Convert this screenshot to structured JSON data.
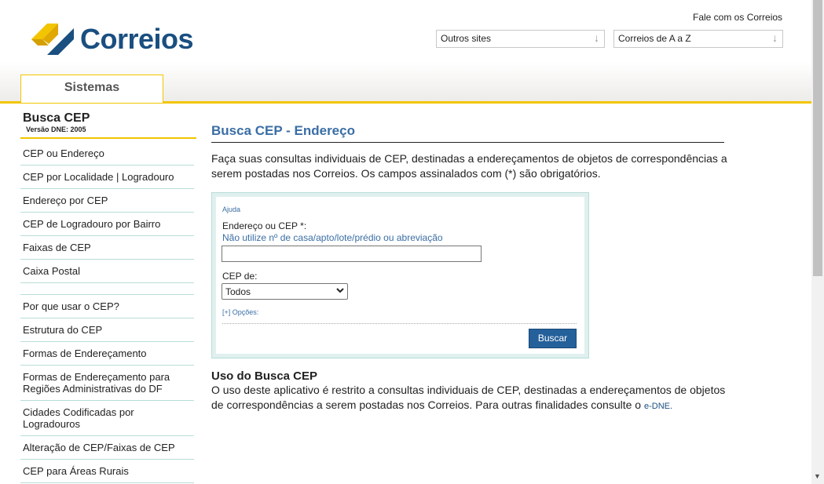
{
  "header": {
    "logo_text": "Correios",
    "fale_link": "Fale com os Correios",
    "dropdown1": "Outros sites",
    "dropdown2": "Correios de A a Z",
    "tab": "Sistemas"
  },
  "sidebar": {
    "title": "Busca CEP",
    "version": "Versão DNE: 2005",
    "items": [
      {
        "label": "CEP ou Endereço"
      },
      {
        "label": "CEP por Localidade | Logradouro"
      },
      {
        "label": "Endereço por CEP"
      },
      {
        "label": "CEP de Logradouro por Bairro"
      },
      {
        "label": "Faixas de CEP"
      },
      {
        "label": "Caixa Postal"
      },
      {
        "label": ""
      },
      {
        "label": "Por que usar o CEP?"
      },
      {
        "label": "Estrutura do CEP"
      },
      {
        "label": "Formas de Endereçamento"
      },
      {
        "label": "Formas de Endereçamento para Regiões Administrativas do DF"
      },
      {
        "label": "Cidades Codificadas por Logradouros"
      },
      {
        "label": "Alteração de CEP/Faixas de CEP"
      },
      {
        "label": "CEP para Áreas Rurais"
      }
    ]
  },
  "main": {
    "title": "Busca CEP - Endereço",
    "intro": "Faça suas consultas individuais de CEP, destinadas a endereçamentos de objetos de correspondências a serem postadas nos Correios. Os campos assinalados com (*) são obrigatórios.",
    "form": {
      "help_link": "Ajuda",
      "address_label": "Endereço ou CEP *:",
      "address_hint": "Não utilize nº de casa/apto/lote/prédio ou abreviação",
      "address_value": "",
      "cep_label": "CEP de:",
      "cep_selected": "Todos",
      "options_link": "[+] Opções:",
      "search_button": "Buscar"
    },
    "usage_title": "Uso do Busca CEP",
    "usage_text": "O uso deste aplicativo é restrito a consultas individuais de CEP, destinadas a endereçamentos de objetos de correspondências a serem postadas nos Correios. Para outras finalidades consulte o",
    "usage_link": "e-DNE."
  },
  "colors": {
    "brand_blue": "#1a4f80",
    "brand_yellow": "#f2c500",
    "link_blue": "#3a6ea5",
    "button_blue": "#24609a"
  },
  "icons": {
    "logo": "correios-logo-icon",
    "dropdown": "arrow-down-icon",
    "select": "chevron-down-icon"
  }
}
